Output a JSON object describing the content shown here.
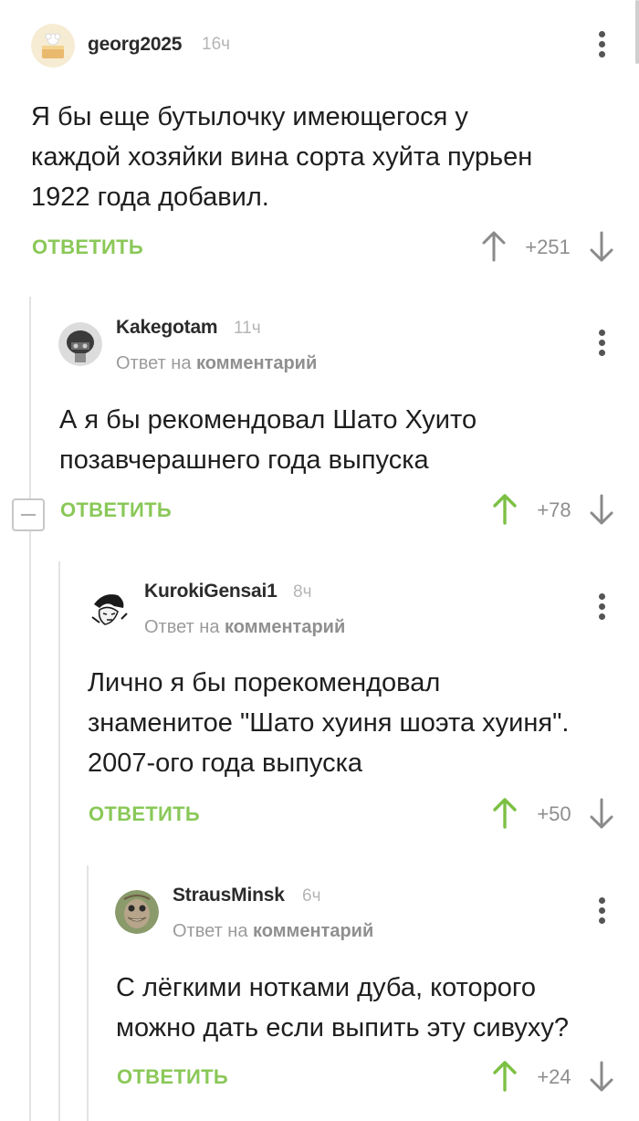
{
  "comments": [
    {
      "username": "georg2025",
      "time": "16ч",
      "reply_to_prefix": "",
      "reply_to_link": "",
      "text_lines": [
        "Я бы еще бутылочку имеющегося у",
        "каждой хозяйки вина сорта хуйта пурьен",
        "1922 года добавил."
      ],
      "reply_label": "ОТВЕТИТЬ",
      "score": "+251",
      "upvoted": false
    },
    {
      "username": "Kakegotam",
      "time": "11ч",
      "reply_to_prefix": "Ответ на",
      "reply_to_link": "комментарий",
      "text_lines": [
        "А я бы рекомендовал Шато Хуито",
        "позавчерашнего года выпуска"
      ],
      "reply_label": "ОТВЕТИТЬ",
      "score": "+78",
      "upvoted": true
    },
    {
      "username": "KurokiGensai1",
      "time": "8ч",
      "reply_to_prefix": "Ответ на",
      "reply_to_link": "комментарий",
      "text_lines": [
        "Лично я бы порекомендовал",
        "знаменитое \"Шато хуиня шоэта хуиня\".",
        "2007-ого года выпуска"
      ],
      "reply_label": "ОТВЕТИТЬ",
      "score": "+50",
      "upvoted": true
    },
    {
      "username": "StrausMinsk",
      "time": "6ч",
      "reply_to_prefix": "Ответ на",
      "reply_to_link": "комментарий",
      "text_lines": [
        "С лёгкими нотками дуба, которого",
        "можно дать если выпить эту сивуху?"
      ],
      "reply_label": "ОТВЕТИТЬ",
      "score": "+24",
      "upvoted": true
    }
  ],
  "colors": {
    "accent_green": "#8ac858",
    "upvote_green": "#7cc043",
    "neutral_arrow": "#888888"
  }
}
